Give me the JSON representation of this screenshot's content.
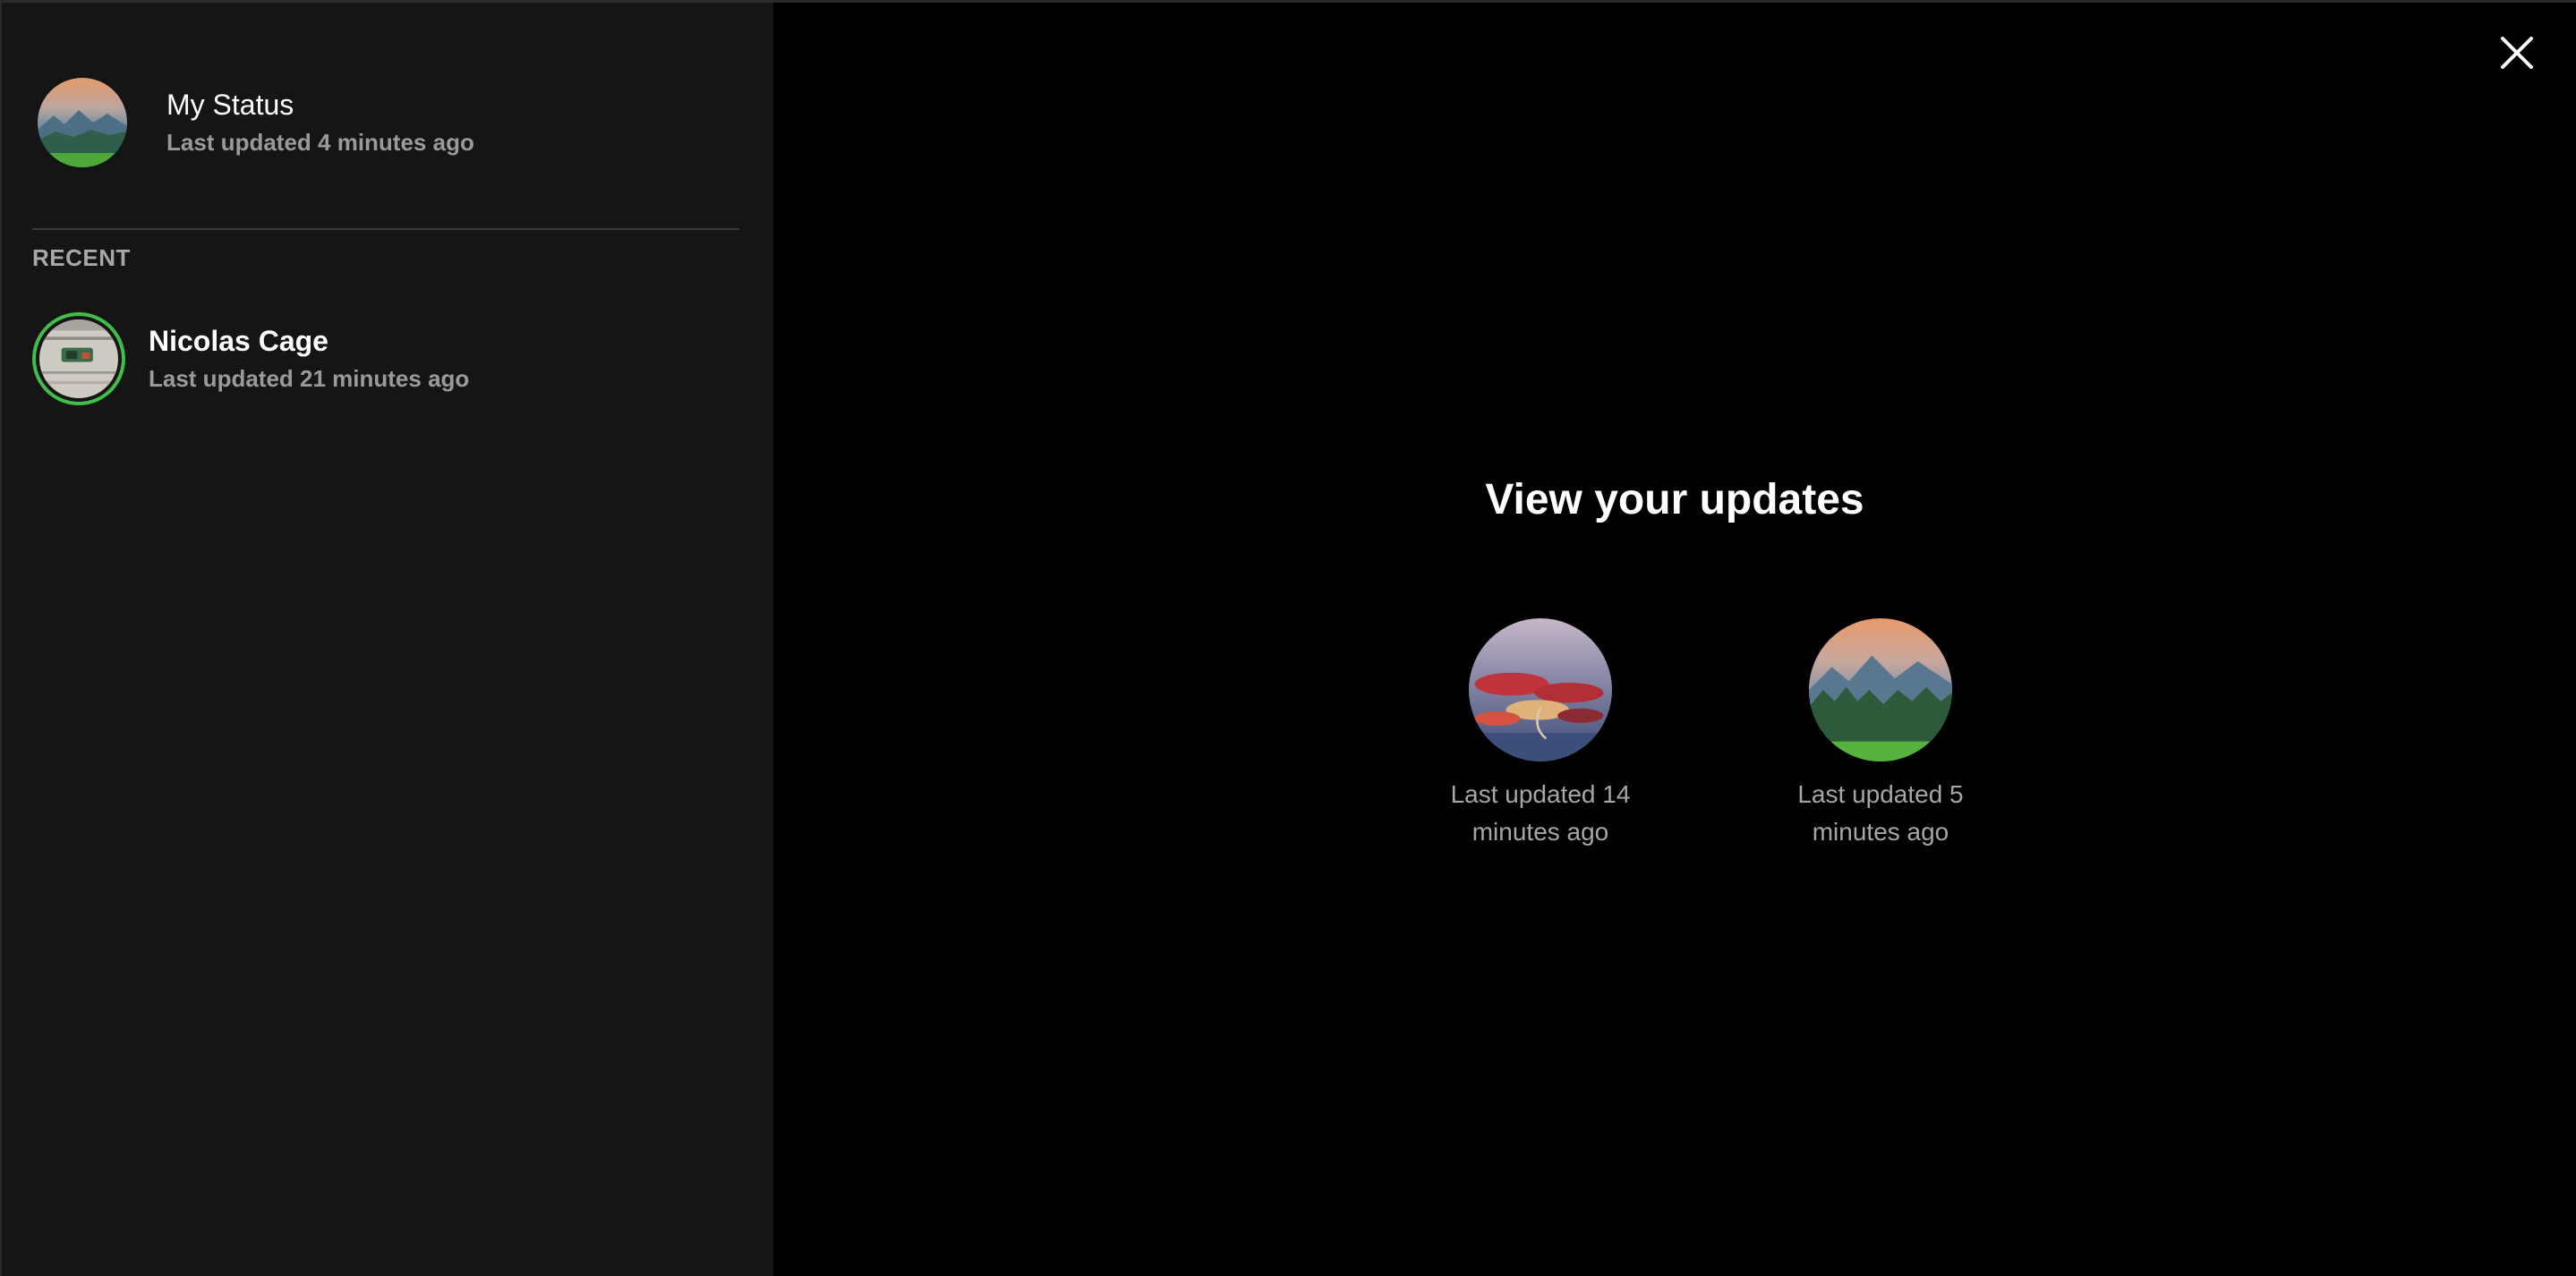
{
  "sidebar": {
    "my_status": {
      "name": "My Status",
      "subtitle": "Last updated 4 minutes ago"
    },
    "section_label": "RECENT",
    "recent": [
      {
        "name": "Nicolas Cage",
        "subtitle": "Last updated 21 minutes ago"
      }
    ]
  },
  "main": {
    "title": "View your updates",
    "updates": [
      {
        "caption": "Last updated 14 minutes ago"
      },
      {
        "caption": "Last updated 5 minutes ago"
      }
    ]
  },
  "icons": {
    "close": "close-icon"
  },
  "colors": {
    "sidebar_bg": "#151515",
    "main_bg": "#000000",
    "accent_ring": "#3fbf4a",
    "text_primary": "#ffffff",
    "text_secondary": "#9a9a9a"
  }
}
